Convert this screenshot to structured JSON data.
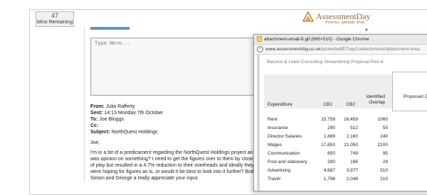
{
  "timer": {
    "value": "47",
    "label": "Mins Remaining"
  },
  "logo": {
    "name": "AssessmentDay",
    "tagline": "Practice Aptitude Tests"
  },
  "reply": {
    "placeholder": "Type Here..."
  },
  "email": {
    "from_label": "From:",
    "from": "Julia Rafferty",
    "sent_label": "Sent:",
    "sent": "14:13 Monday 7th October",
    "to_label": "To:",
    "to": "Joe Bloggs",
    "cc_label": "Cc:",
    "cc": "",
    "subject_label": "Subject:",
    "subject": "NorthQuest Holdings",
    "greeting": "Joe,",
    "body": "I'm in a bit of a predicament regarding the NorthQuest Holdings project and was opinion on something? I need to get the figures over to them by close of play but resulted in a 4.7% reduction to their overheads and ideally they were hoping for figures as is, or would it be best to look into it further? Both Simon and George a really appreciate your input."
  },
  "popup": {
    "window_title": "attachment-email-8.gif (695×510) - Google Chrome",
    "url_host": "www.assessmentday.co.uk",
    "url_path": "/protected/ETray/1/attachments/attachment-ema",
    "doc_title": "Bannon & Loew Consulting Streamlining Proposal-Rev-4",
    "columns": [
      "Expenditure",
      "CB1",
      "CB2",
      "Identified Overlap",
      "Proposed Ov Strea"
    ],
    "rows": [
      [
        "Rent",
        "15,759",
        "18,459",
        "1060"
      ],
      [
        "Insurance",
        "290",
        "512",
        "55"
      ],
      [
        "Director Salaries",
        "1,869",
        "2,160",
        "240"
      ],
      [
        "Wages",
        "17,853",
        "21,050",
        "2100"
      ],
      [
        "Communication",
        "650",
        "749",
        "95"
      ],
      [
        "Post and stationery",
        "290",
        "186",
        "29"
      ],
      [
        "Advertising",
        "4,687",
        "3,977",
        "510"
      ],
      [
        "Travel",
        "1,798",
        "2,048",
        "210"
      ]
    ]
  }
}
